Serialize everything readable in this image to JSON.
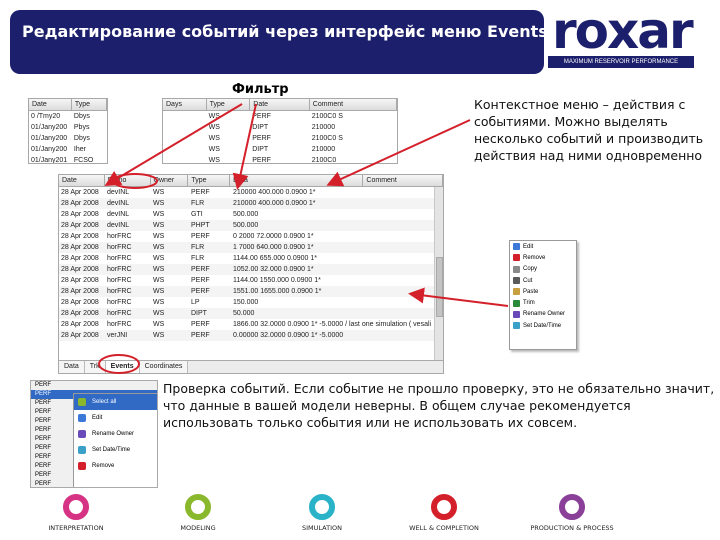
{
  "slide": {
    "title": "Редактирование событий через интерфейс меню Events",
    "filter_label": "Фильтр",
    "context_description": "Контекстное меню – действия с событиями. Можно выделять несколько событий и производить действия над ними одновременно",
    "validation_description": "Проверка событий. Если событие не прошло проверку, это не обязательно значит, что данные в вашей модели неверны. В общем случае рекомендуется использовать только события или не использовать их совсем."
  },
  "logo": {
    "name": "roxar",
    "tagline": "MAXIMUM RESERVOIR PERFORMANCE"
  },
  "colors": {
    "title_bg": "#1c1f6b",
    "arrow": "#d4202a",
    "highlight": "#316ac5"
  },
  "small_grid_1": {
    "columns": [
      "Date",
      "Type"
    ],
    "rows": [
      [
        "0 /Tmy20",
        "Dbys"
      ],
      [
        "01/Jany200",
        "Pbys"
      ],
      [
        "01/Jany200",
        "Dbys"
      ],
      [
        "01/Jany200",
        "Iher"
      ],
      [
        "01/Jany201",
        "FCSO"
      ]
    ]
  },
  "small_grid_2": {
    "columns": [
      "Days",
      "Type",
      "Date",
      "Comment"
    ],
    "rows": [
      [
        "",
        "WS",
        "PERF",
        "2100C0 S"
      ],
      [
        "",
        "WS",
        "DIPT",
        "210000"
      ],
      [
        "",
        "WS",
        "PERF",
        "2100C0 S"
      ],
      [
        "",
        "WS",
        "DIPT",
        "210000"
      ],
      [
        "",
        "WS",
        "PERF",
        "2100C0"
      ]
    ]
  },
  "main_grid": {
    "columns": [
      "Date",
      "Prono",
      "Owner",
      "Type",
      "Data",
      "Comment"
    ],
    "rows": [
      [
        "28 Apr 2008",
        "devINL",
        "WS",
        "PERF",
        "210000 400.000 0.0900 1*"
      ],
      [
        "28 Apr 2008",
        "devINL",
        "WS",
        "FLR",
        "210000 400.000 0.0900 1*"
      ],
      [
        "28 Apr 2008",
        "devINL",
        "WS",
        "GTI",
        "500.000"
      ],
      [
        "28 Apr 2008",
        "devINL",
        "WS",
        "PHPT",
        "500.000"
      ],
      [
        "28 Apr 2008",
        "horFRC",
        "WS",
        "PERF",
        "0 2000 72.0000 0.0900 1*"
      ],
      [
        "28 Apr 2008",
        "horFRC",
        "WS",
        "FLR",
        "1 7000 640.000 0.0900 1*"
      ],
      [
        "28 Apr 2008",
        "horFRC",
        "WS",
        "FLR",
        "1144.00 655.000 0.0900 1*"
      ],
      [
        "28 Apr 2008",
        "horFRC",
        "WS",
        "PERF",
        "1052.00 32.000 0.0900 1*"
      ],
      [
        "28 Apr 2008",
        "horFRC",
        "WS",
        "PERF",
        "1144.00 1550.000 0.0900 1*"
      ],
      [
        "28 Apr 2008",
        "horFRC",
        "WS",
        "PERF",
        "1551.00 1655.000 0.0900 1*"
      ],
      [
        "28 Apr 2008",
        "horFRC",
        "WS",
        "LP",
        "150.000"
      ],
      [
        "28 Apr 2008",
        "horFRC",
        "WS",
        "DIPT",
        "50.000"
      ],
      [
        "28 Apr 2008",
        "horFRC",
        "WS",
        "PERF",
        "1866.00 32.0000 0.0900 1* -5.0000 / last one simulation ( vesalir)"
      ],
      [
        "28 Apr 2008",
        "verJNI",
        "WS",
        "PERF",
        "0.00000 32.0000 0.0900 1* -5.0000"
      ]
    ],
    "tabs": [
      "Data",
      "Trk",
      "Events",
      "Coordinates"
    ]
  },
  "context_menu": {
    "items": [
      "Edit",
      "Remove",
      "Copy",
      "Cut",
      "Paste",
      "Trim",
      "Rename Owner",
      "Set Date/Time"
    ]
  },
  "validation_panel": {
    "rows": [
      "PERF",
      "PERF",
      "PERF",
      "PERF",
      "PERF",
      "PERF",
      "PERF",
      "PERF",
      "PERF",
      "PERF",
      "PERF",
      "PERF"
    ],
    "submenu": [
      "Select all",
      "Edit",
      "Rename Owner",
      "Set Date/Time",
      "Remove"
    ]
  },
  "footer": {
    "items": [
      {
        "label": "INTERPRETATION",
        "color": "#d63384"
      },
      {
        "label": "MODELING",
        "color": "#8ab82c"
      },
      {
        "label": "SIMULATION",
        "color": "#2ab3c8"
      },
      {
        "label": "WELL & COMPLETION",
        "color": "#d4202a"
      },
      {
        "label": "PRODUCTION & PROCESS",
        "color": "#8a3f98"
      }
    ]
  }
}
